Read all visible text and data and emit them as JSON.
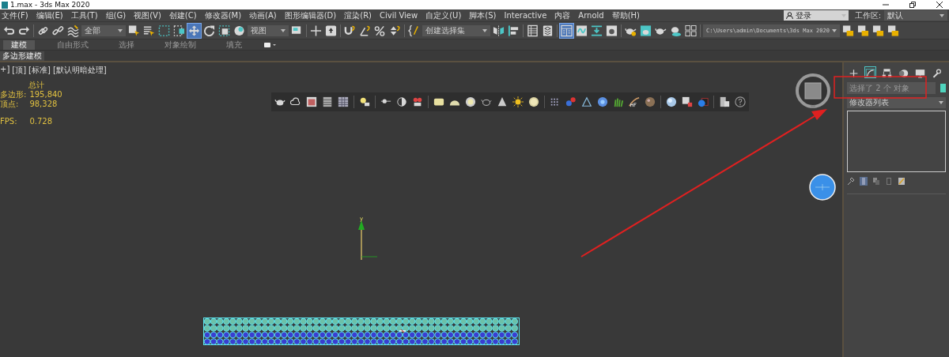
{
  "window": {
    "title": "1.max - 3ds Max 2020"
  },
  "menu_bar": {
    "items": [
      "文件(F)",
      "编辑(E)",
      "工具(T)",
      "组(G)",
      "视图(V)",
      "创建(C)",
      "修改器(M)",
      "动画(A)",
      "图形编辑器(D)",
      "渲染(R)",
      "Civil View",
      "自定义(U)",
      "脚本(S)",
      "Interactive",
      "内容",
      "Arnold",
      "帮助(H)"
    ]
  },
  "account": {
    "label": "登录"
  },
  "workspace": {
    "label": "工作区:",
    "value": "默认"
  },
  "toolbar": {
    "groups": [
      [
        {
          "kind": "undo",
          "selected": false
        },
        {
          "kind": "redo",
          "selected": false
        }
      ],
      [
        {
          "kind": "link",
          "selected": false
        },
        {
          "kind": "unlink",
          "selected": false
        },
        {
          "kind": "wave",
          "selected": false
        },
        {
          "kind": "dropdown",
          "value": "全部"
        },
        {
          "kind": "select",
          "selected": false
        },
        {
          "kind": "select-list",
          "selected": false
        },
        {
          "kind": "rect-select",
          "selected": false
        },
        {
          "kind": "crossing",
          "selected": false
        },
        {
          "kind": "move",
          "selected": true
        },
        {
          "kind": "rotate",
          "selected": false
        },
        {
          "kind": "scale",
          "selected": false
        },
        {
          "kind": "place",
          "selected": false
        },
        {
          "kind": "dropdown",
          "value": "视图"
        },
        {
          "kind": "pivot",
          "selected": false
        }
      ],
      [
        {
          "kind": "crosshair",
          "selected": false
        },
        {
          "kind": "manipulate",
          "selected": false
        }
      ],
      [
        {
          "kind": "snap",
          "selected": false
        },
        {
          "kind": "angle",
          "selected": false
        },
        {
          "kind": "percent",
          "selected": false
        },
        {
          "kind": "spinner",
          "selected": false
        }
      ],
      [
        {
          "kind": "braces",
          "selected": false
        },
        {
          "kind": "dropdown",
          "value": "创建选择集"
        },
        {
          "kind": "mirror",
          "selected": false
        },
        {
          "kind": "align",
          "selected": false
        }
      ],
      [
        {
          "kind": "table",
          "selected": false
        },
        {
          "kind": "layers",
          "selected": false
        }
      ],
      [
        {
          "kind": "ribbon",
          "selected": true
        },
        {
          "kind": "curve",
          "selected": false
        },
        {
          "kind": "download",
          "selected": false
        },
        {
          "kind": "material",
          "selected": false
        }
      ],
      [
        {
          "kind": "render-setup",
          "selected": false
        },
        {
          "kind": "frame",
          "selected": false
        },
        {
          "kind": "render",
          "selected": false
        },
        {
          "kind": "render-cloud",
          "selected": false
        },
        {
          "kind": "grid",
          "selected": false
        }
      ],
      [
        {
          "kind": "dropdown",
          "value": "C:\\Users\\admin\\Documents\\3ds Max 2020"
        },
        {
          "kind": "project",
          "selected": false
        },
        {
          "kind": "project",
          "selected": false
        },
        {
          "kind": "project",
          "selected": false
        },
        {
          "kind": "project",
          "selected": false
        }
      ]
    ]
  },
  "ribbon": {
    "tabs": [
      {
        "label": "建模",
        "selected": true
      },
      {
        "label": "自由形式",
        "selected": false
      },
      {
        "label": "选择",
        "selected": false
      },
      {
        "label": "对象绘制",
        "selected": false
      },
      {
        "label": "填充",
        "selected": false
      }
    ],
    "panel": "多边形建模"
  },
  "viewport": {
    "labels": [
      "+]",
      "[顶]",
      "[标准]",
      "[默认明暗处理]"
    ],
    "stats": {
      "heading": "总计",
      "rows": [
        {
          "label": "多边形:",
          "value": "195,840"
        },
        {
          "label": "顶点:",
          "value": "98,328"
        }
      ],
      "fps_label": "FPS:",
      "fps_value": "0.728"
    },
    "axis_label": "y"
  },
  "command_panel": {
    "tabs": [
      {
        "kind": "create",
        "selected": false
      },
      {
        "kind": "modify",
        "selected": true
      },
      {
        "kind": "hierarchy",
        "selected": false
      },
      {
        "kind": "motion",
        "selected": false
      },
      {
        "kind": "display",
        "selected": false
      },
      {
        "kind": "utilities",
        "selected": false
      }
    ],
    "selection_name": "选择了 2 个 对象",
    "modifier_list": "修改器列表"
  }
}
